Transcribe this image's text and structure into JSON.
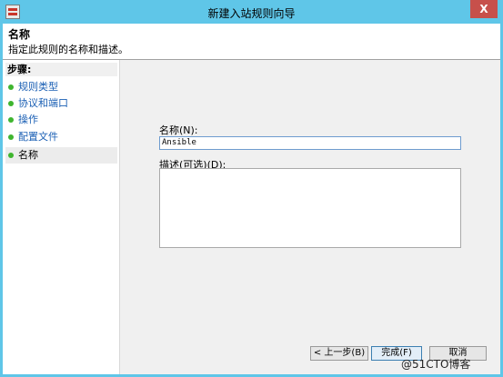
{
  "window": {
    "title": "新建入站规则向导",
    "close_label": "X"
  },
  "header": {
    "title": "名称",
    "description": "指定此规则的名称和描述。"
  },
  "sidebar": {
    "heading": "步骤:",
    "items": [
      {
        "label": "规则类型",
        "status": "done"
      },
      {
        "label": "协议和端口",
        "status": "done"
      },
      {
        "label": "操作",
        "status": "done"
      },
      {
        "label": "配置文件",
        "status": "done"
      },
      {
        "label": "名称",
        "status": "current"
      }
    ]
  },
  "form": {
    "name_label": "名称(N):",
    "name_value": "Ansible",
    "description_label": "描述(可选)(D):",
    "description_value": ""
  },
  "buttons": {
    "back": "< 上一步(B)",
    "finish": "完成(F)",
    "cancel": "取消"
  },
  "watermark": "@51CTO博客",
  "colors": {
    "titlebar": "#5fc6e8",
    "link": "#1a5fb4",
    "step_dot": "#3fb52f",
    "close": "#c7504b"
  }
}
